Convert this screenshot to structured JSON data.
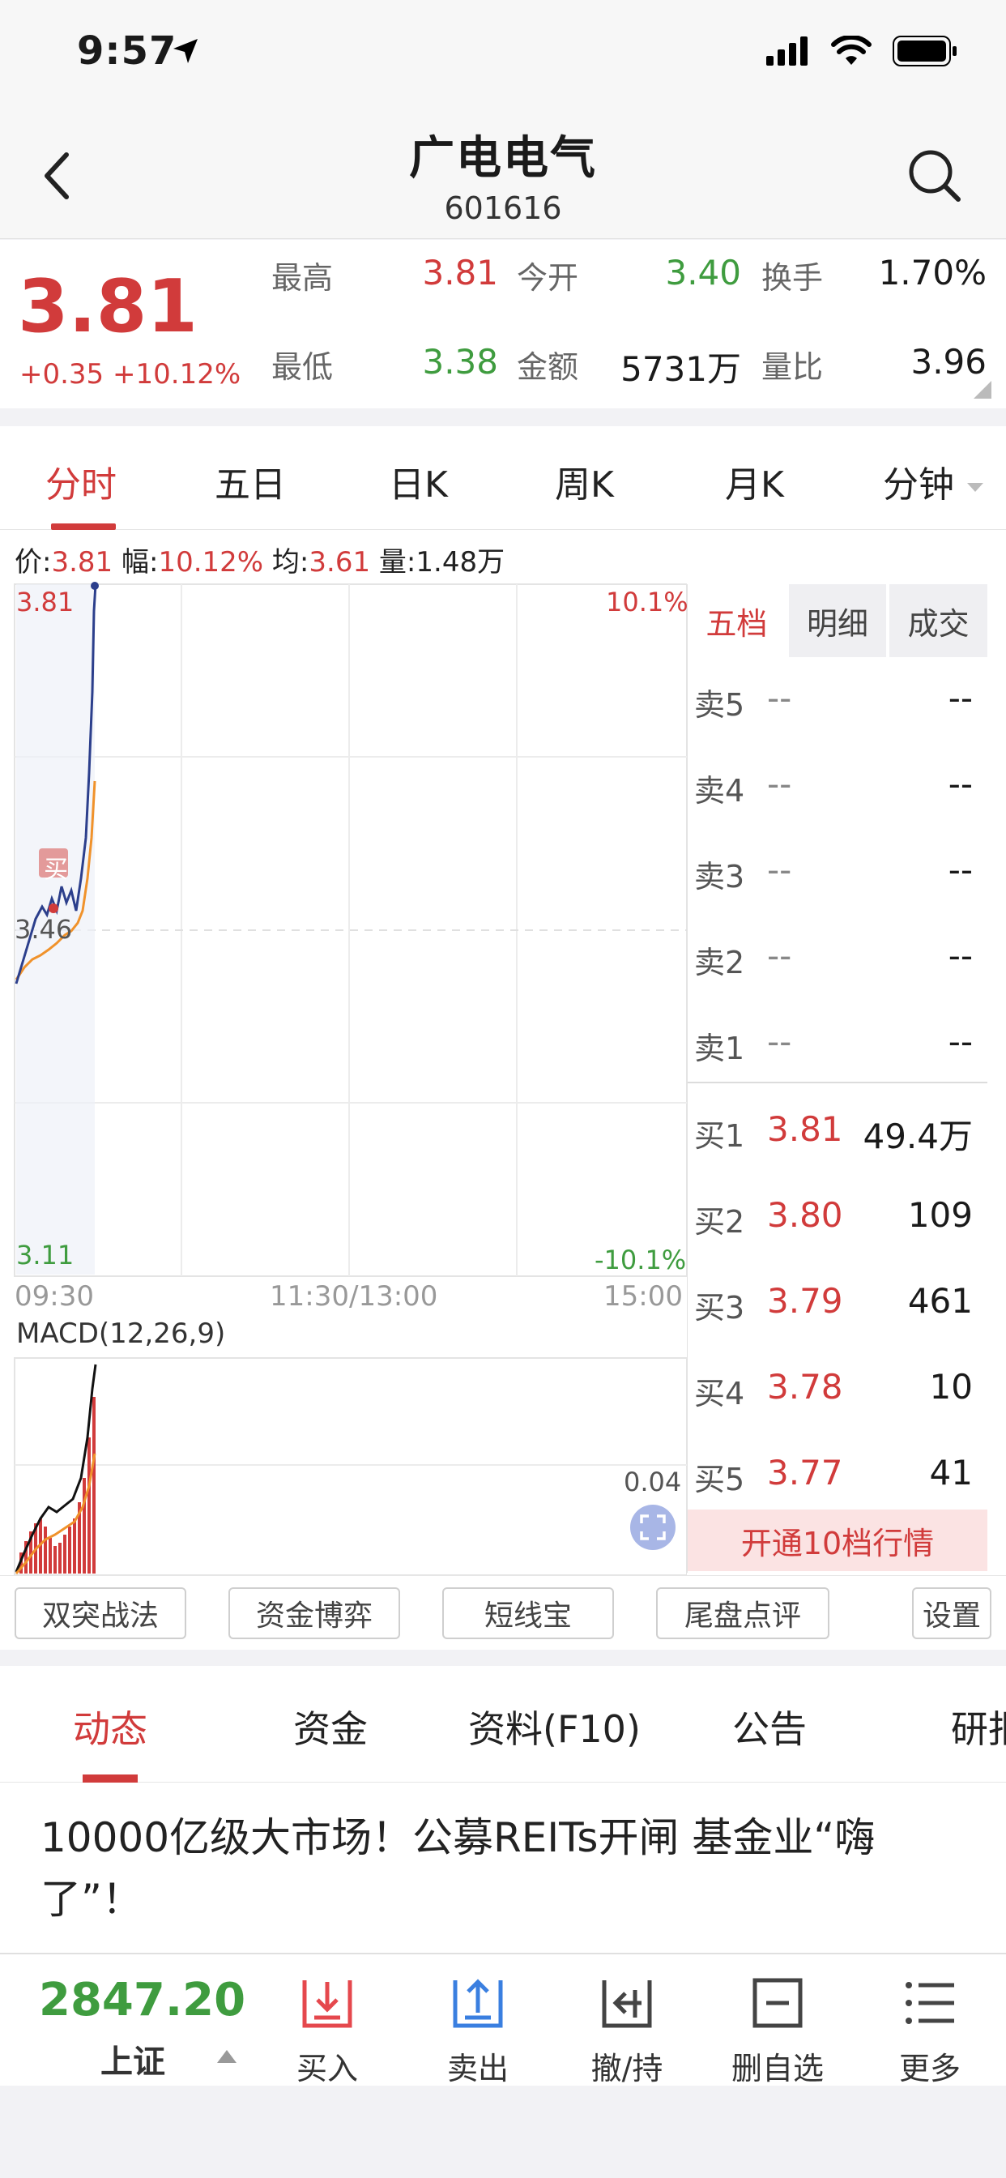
{
  "status": {
    "time": "9:57"
  },
  "nav": {
    "title": "广电电气",
    "code": "601616"
  },
  "quote": {
    "price": "3.81",
    "change": "+0.35",
    "change_pct": "+10.12%",
    "fields": [
      {
        "label": "最高",
        "value": "3.81",
        "color": "red"
      },
      {
        "label": "今开",
        "value": "3.40",
        "color": "green"
      },
      {
        "label": "换手",
        "value": "1.70%",
        "color": "black"
      },
      {
        "label": "最低",
        "value": "3.38",
        "color": "green"
      },
      {
        "label": "金额",
        "value": "5731万",
        "color": "black"
      },
      {
        "label": "量比",
        "value": "3.96",
        "color": "black"
      }
    ]
  },
  "period_tabs": [
    "分时",
    "五日",
    "日K",
    "周K",
    "月K",
    "分钟"
  ],
  "info": {
    "price_label": "价:",
    "price": "3.81",
    "amp_label": "幅:",
    "amp": "10.12%",
    "avg_label": "均:",
    "avg": "3.61",
    "vol_label": "量:",
    "vol": "1.48万"
  },
  "chart": {
    "y_top": "3.81",
    "y_mid": "3.46",
    "y_bottom": "3.11",
    "pct_top": "10.1%",
    "pct_bottom": "-10.1%",
    "t_start": "09:30",
    "t_mid": "11:30/13:00",
    "t_end": "15:00",
    "buy_marker": "买",
    "macd_label": "MACD(12,26,9)",
    "macd_value": "0.04"
  },
  "book": {
    "tabs": [
      "五档",
      "明细",
      "成交"
    ],
    "asks": [
      {
        "label": "卖5",
        "price": "--",
        "vol": "--"
      },
      {
        "label": "卖4",
        "price": "--",
        "vol": "--"
      },
      {
        "label": "卖3",
        "price": "--",
        "vol": "--"
      },
      {
        "label": "卖2",
        "price": "--",
        "vol": "--"
      },
      {
        "label": "卖1",
        "price": "--",
        "vol": "--"
      }
    ],
    "bids": [
      {
        "label": "买1",
        "price": "3.81",
        "vol": "49.4万"
      },
      {
        "label": "买2",
        "price": "3.80",
        "vol": "109"
      },
      {
        "label": "买3",
        "price": "3.79",
        "vol": "461"
      },
      {
        "label": "买4",
        "price": "3.78",
        "vol": "10"
      },
      {
        "label": "买5",
        "price": "3.77",
        "vol": "41"
      }
    ],
    "cta": "开通10档行情"
  },
  "tools": [
    "双突战法",
    "资金博弈",
    "短线宝",
    "尾盘点评",
    "设置"
  ],
  "news_tabs": [
    "动态",
    "资金",
    "资料(F10)",
    "公告",
    "研报"
  ],
  "news": {
    "headline": "10000亿级大市场！公募REITs开闸 基金业“嗨了”！"
  },
  "bottom": {
    "index_value": "2847.20",
    "index_name": "上证",
    "items": [
      "买入",
      "卖出",
      "撤/持",
      "删自选",
      "更多"
    ]
  },
  "colors": {
    "red": "#d13b3b",
    "green": "#3f9c3f",
    "price_line": "#2c3f8c",
    "avg_line": "#f0922b"
  }
}
